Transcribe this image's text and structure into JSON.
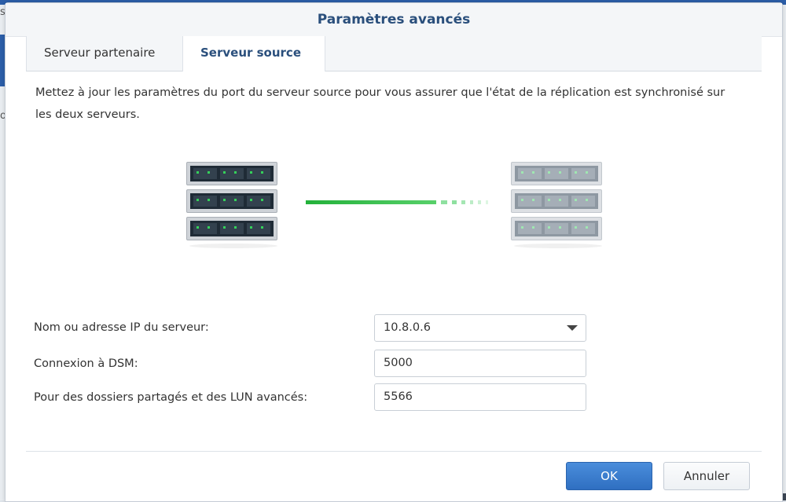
{
  "background": {
    "left_text_top": "s",
    "left_text_mid": "o",
    "bottom_mark": "✕"
  },
  "dialog": {
    "title": "Paramètres avancés",
    "tabs": [
      {
        "label": "Serveur partenaire",
        "active": false
      },
      {
        "label": "Serveur source",
        "active": true
      }
    ],
    "description": "Mettez à jour les paramètres du port du serveur source pour vous assurer que l'état de la réplication est synchronisé sur les deux serveurs.",
    "illustration": {
      "left_icon": "server-rack-icon",
      "right_icon": "server-rack-icon",
      "link_color": "#2fbf4a"
    },
    "form": {
      "ip_label": "Nom ou adresse IP du serveur:",
      "ip_value": "10.8.0.6",
      "dsm_label": "Connexion à DSM:",
      "dsm_value": "5000",
      "lun_label": "Pour des dossiers partagés et des LUN avancés:",
      "lun_value": "5566"
    },
    "buttons": {
      "ok": "OK",
      "cancel": "Annuler"
    }
  },
  "colors": {
    "accent": "#2f6fc1",
    "title": "#2a4f7c"
  }
}
